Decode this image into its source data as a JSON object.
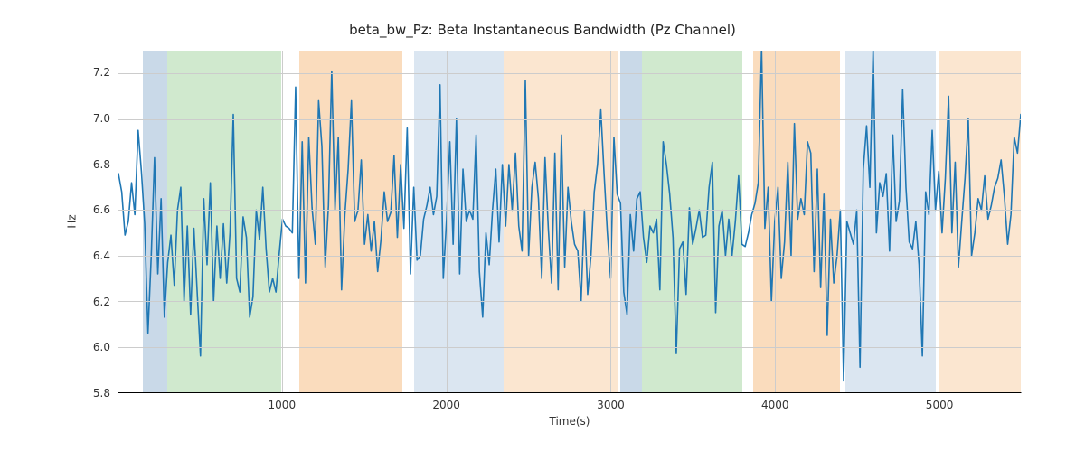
{
  "chart_data": {
    "type": "line",
    "title": "beta_bw_Pz: Beta Instantaneous Bandwidth (Pz Channel)",
    "xlabel": "Time(s)",
    "ylabel": "Hz",
    "xlim": [
      0,
      5500
    ],
    "ylim": [
      5.8,
      7.3
    ],
    "xticks": [
      1000,
      2000,
      3000,
      4000,
      5000
    ],
    "yticks": [
      5.8,
      6.0,
      6.2,
      6.4,
      6.6,
      6.8,
      7.0,
      7.2
    ],
    "bands": [
      {
        "x0": 150,
        "x1": 300,
        "color": "#c9d9e8"
      },
      {
        "x0": 300,
        "x1": 990,
        "color": "#d0e9ce"
      },
      {
        "x0": 1100,
        "x1": 1730,
        "color": "#fadcbd"
      },
      {
        "x0": 1800,
        "x1": 2350,
        "color": "#dbe6f1"
      },
      {
        "x0": 2350,
        "x1": 3040,
        "color": "#fbe6d0"
      },
      {
        "x0": 3060,
        "x1": 3190,
        "color": "#c9d9e8"
      },
      {
        "x0": 3190,
        "x1": 3800,
        "color": "#d0e9ce"
      },
      {
        "x0": 3870,
        "x1": 4400,
        "color": "#fadcbd"
      },
      {
        "x0": 4430,
        "x1": 4980,
        "color": "#dbe6f1"
      },
      {
        "x0": 5005,
        "x1": 5500,
        "color": "#fbe6d0"
      }
    ],
    "series": [
      {
        "name": "beta_bw_Pz",
        "color": "#1f77b4",
        "x_step": 20,
        "x_start": 0,
        "y": [
          6.76,
          6.68,
          6.49,
          6.55,
          6.72,
          6.58,
          6.95,
          6.77,
          6.54,
          6.06,
          6.4,
          6.83,
          6.32,
          6.65,
          6.13,
          6.37,
          6.49,
          6.27,
          6.6,
          6.7,
          6.2,
          6.53,
          6.14,
          6.52,
          6.24,
          5.96,
          6.65,
          6.36,
          6.72,
          6.2,
          6.53,
          6.3,
          6.54,
          6.28,
          6.5,
          7.02,
          6.3,
          6.24,
          6.57,
          6.48,
          6.13,
          6.22,
          6.6,
          6.47,
          6.7,
          6.43,
          6.24,
          6.3,
          6.24,
          6.41,
          6.56,
          6.53,
          6.52,
          6.5,
          7.14,
          6.3,
          6.9,
          6.28,
          6.92,
          6.61,
          6.45,
          7.08,
          6.88,
          6.35,
          6.62,
          7.21,
          6.6,
          6.92,
          6.25,
          6.58,
          6.78,
          7.08,
          6.55,
          6.6,
          6.82,
          6.45,
          6.58,
          6.42,
          6.55,
          6.33,
          6.47,
          6.68,
          6.55,
          6.59,
          6.84,
          6.48,
          6.8,
          6.52,
          6.96,
          6.32,
          6.7,
          6.38,
          6.4,
          6.56,
          6.62,
          6.7,
          6.58,
          6.66,
          7.15,
          6.3,
          6.56,
          6.9,
          6.45,
          7.0,
          6.32,
          6.78,
          6.55,
          6.6,
          6.56,
          6.93,
          6.33,
          6.13,
          6.5,
          6.36,
          6.6,
          6.78,
          6.46,
          6.8,
          6.53,
          6.8,
          6.6,
          6.85,
          6.53,
          6.42,
          7.17,
          6.4,
          6.7,
          6.81,
          6.65,
          6.3,
          6.83,
          6.52,
          6.28,
          6.85,
          6.25,
          6.93,
          6.35,
          6.7,
          6.55,
          6.45,
          6.42,
          6.2,
          6.6,
          6.23,
          6.4,
          6.68,
          6.8,
          7.04,
          6.76,
          6.5,
          6.3,
          6.92,
          6.67,
          6.63,
          6.24,
          6.14,
          6.58,
          6.42,
          6.65,
          6.68,
          6.48,
          6.37,
          6.53,
          6.5,
          6.56,
          6.25,
          6.9,
          6.8,
          6.67,
          6.48,
          5.97,
          6.43,
          6.46,
          6.23,
          6.61,
          6.45,
          6.52,
          6.6,
          6.48,
          6.49,
          6.7,
          6.81,
          6.15,
          6.53,
          6.6,
          6.4,
          6.56,
          6.4,
          6.55,
          6.75,
          6.45,
          6.44,
          6.5,
          6.58,
          6.63,
          6.72,
          7.31,
          6.52,
          6.7,
          6.2,
          6.55,
          6.7,
          6.3,
          6.46,
          6.81,
          6.4,
          6.98,
          6.56,
          6.65,
          6.58,
          6.9,
          6.85,
          6.33,
          6.78,
          6.26,
          6.67,
          6.05,
          6.56,
          6.28,
          6.4,
          6.6,
          5.85,
          6.55,
          6.5,
          6.45,
          6.6,
          5.91,
          6.78,
          6.97,
          6.7,
          7.31,
          6.5,
          6.72,
          6.66,
          6.76,
          6.42,
          6.93,
          6.55,
          6.64,
          7.13,
          6.7,
          6.46,
          6.43,
          6.55,
          6.36,
          5.96,
          6.68,
          6.58,
          6.95,
          6.6,
          6.77,
          6.5,
          6.74,
          7.1,
          6.5,
          6.81,
          6.35,
          6.55,
          6.74,
          7.0,
          6.4,
          6.5,
          6.65,
          6.6,
          6.75,
          6.56,
          6.62,
          6.7,
          6.74,
          6.82,
          6.66,
          6.45,
          6.58,
          6.92,
          6.85,
          7.02
        ]
      }
    ]
  }
}
